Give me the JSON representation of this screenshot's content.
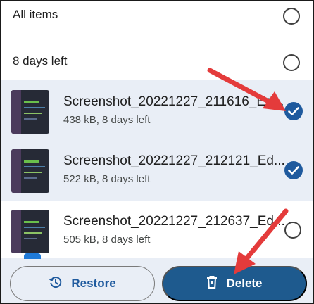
{
  "sections": {
    "all_items_label": "All items",
    "days_left_label": "8 days left"
  },
  "files": [
    {
      "name": "Screenshot_20221227_211616_Ed...",
      "meta": "438 kB, 8 days left",
      "selected": true
    },
    {
      "name": "Screenshot_20221227_212121_Ed...",
      "meta": "522 kB, 8 days left",
      "selected": true
    },
    {
      "name": "Screenshot_20221227_212637_Ed...",
      "meta": "505 kB, 8 days left",
      "selected": false
    }
  ],
  "actions": {
    "restore_label": "Restore",
    "delete_label": "Delete"
  },
  "colors": {
    "accent": "#1e5a8e",
    "selected_row": "#e9eef6",
    "annotation_arrow": "#e43b3b"
  },
  "icons": {
    "restore": "history-icon",
    "delete": "trash-icon",
    "selected": "check-circle-icon",
    "unselected": "radio-empty-icon"
  }
}
